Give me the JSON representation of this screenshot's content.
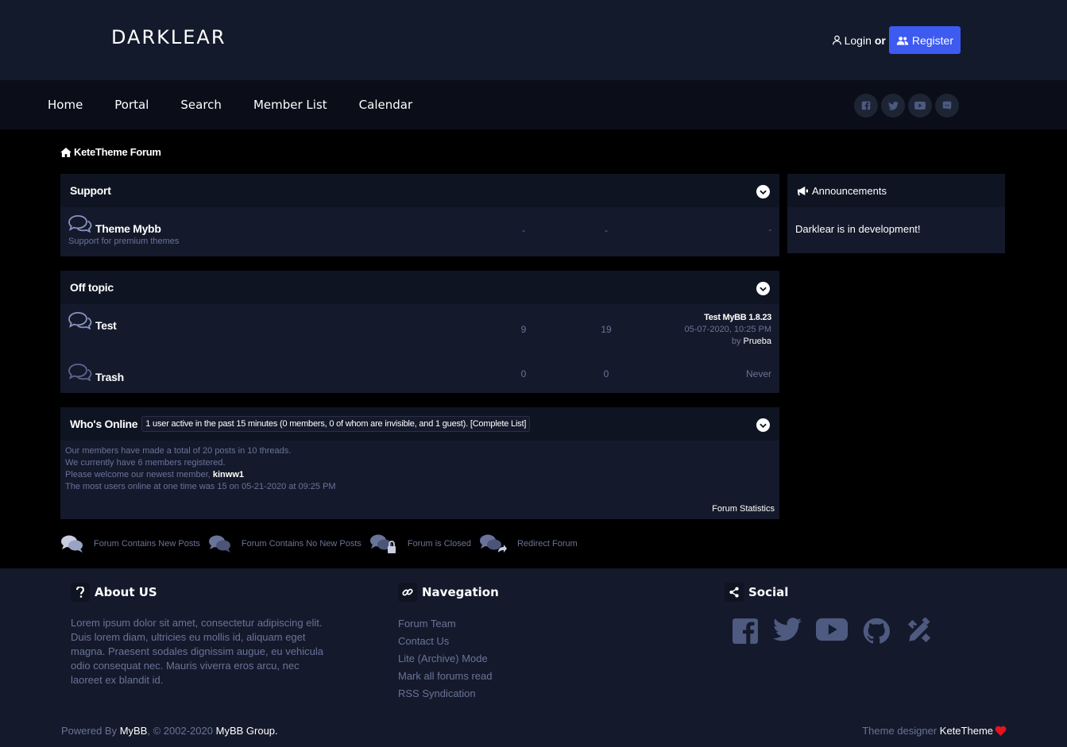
{
  "header": {
    "logo": "DARKLEAR",
    "login_label": "Login",
    "or_label": "or",
    "register_label": "Register"
  },
  "nav": {
    "items": [
      "Home",
      "Portal",
      "Search",
      "Member List",
      "Calendar"
    ],
    "social_icons": [
      "facebook-icon",
      "twitter-icon",
      "youtube-icon",
      "discord-icon"
    ]
  },
  "breadcrumb": {
    "label": "KeteTheme Forum"
  },
  "support": {
    "title": "Support",
    "forums": [
      {
        "name": "Theme Mybb",
        "description": "Support for premium themes",
        "threads": "-",
        "posts": "-",
        "last": "-"
      }
    ]
  },
  "offtopic": {
    "title": "Off topic",
    "forums": [
      {
        "name": "Test",
        "threads": "9",
        "posts": "19",
        "last_title": "Test MyBB 1.8.23",
        "last_date": "05-07-2020, 10:25 PM",
        "last_by": "by",
        "last_user": "Prueba"
      },
      {
        "name": "Trash",
        "threads": "0",
        "posts": "0",
        "last": "Never"
      }
    ]
  },
  "online": {
    "title": "Who's Online",
    "info": "1 user active in the past 15 minutes (0 members, 0 of whom are invisible, and 1 guest). [Complete List]",
    "stat1": "Our members have made a total of 20 posts in 10 threads.",
    "stat2": "We currently have 6 members registered.",
    "stat3_prefix": "Please welcome our newest member,",
    "newest_member": "kinww1",
    "stat4": "The most users online at one time was 15 on 05-21-2020 at 09:25 PM",
    "stats_link": "Forum Statistics"
  },
  "announcements": {
    "title": "Announcements",
    "body": "Darklear is in development!"
  },
  "legend": {
    "new_posts": "Forum Contains New Posts",
    "no_new_posts": "Forum Contains No New Posts",
    "closed": "Forum is Closed",
    "redirect": "Redirect Forum"
  },
  "footer": {
    "about_title": "About US",
    "about_text": "Lorem ipsum dolor sit amet, consectetur adipiscing elit. Duis lorem diam, ultricies eu mollis id, aliquam eget magna. Praesent sodales dignissim augue, eu vehicula odio consequat nec. Mauris viverra eros arcu, nec laoreet ex blandit id.",
    "nav_title": "Navegation",
    "nav_items": [
      "Forum Team",
      "Contact Us",
      "Lite (Archive) Mode",
      "Mark all forums read",
      "RSS Syndication"
    ],
    "social_title": "Social",
    "social_icons": [
      "facebook-icon",
      "twitter-icon",
      "youtube-icon",
      "github-icon",
      "designer-tools-icon"
    ],
    "powered_prefix": "Powered By",
    "powered_link": "MyBB",
    "powered_mid": ", © 2002-2020",
    "group_link": "MyBB Group.",
    "designer_prefix": "Theme designer",
    "designer_link": "KeteTheme"
  },
  "colors": {
    "header_bg": "#131a2c",
    "nav_bg": "#0b0e19",
    "panel_bg": "#141a2b",
    "accent": "#3d5af1",
    "muted_text": "#6a7399",
    "heart": "#e8121f"
  }
}
